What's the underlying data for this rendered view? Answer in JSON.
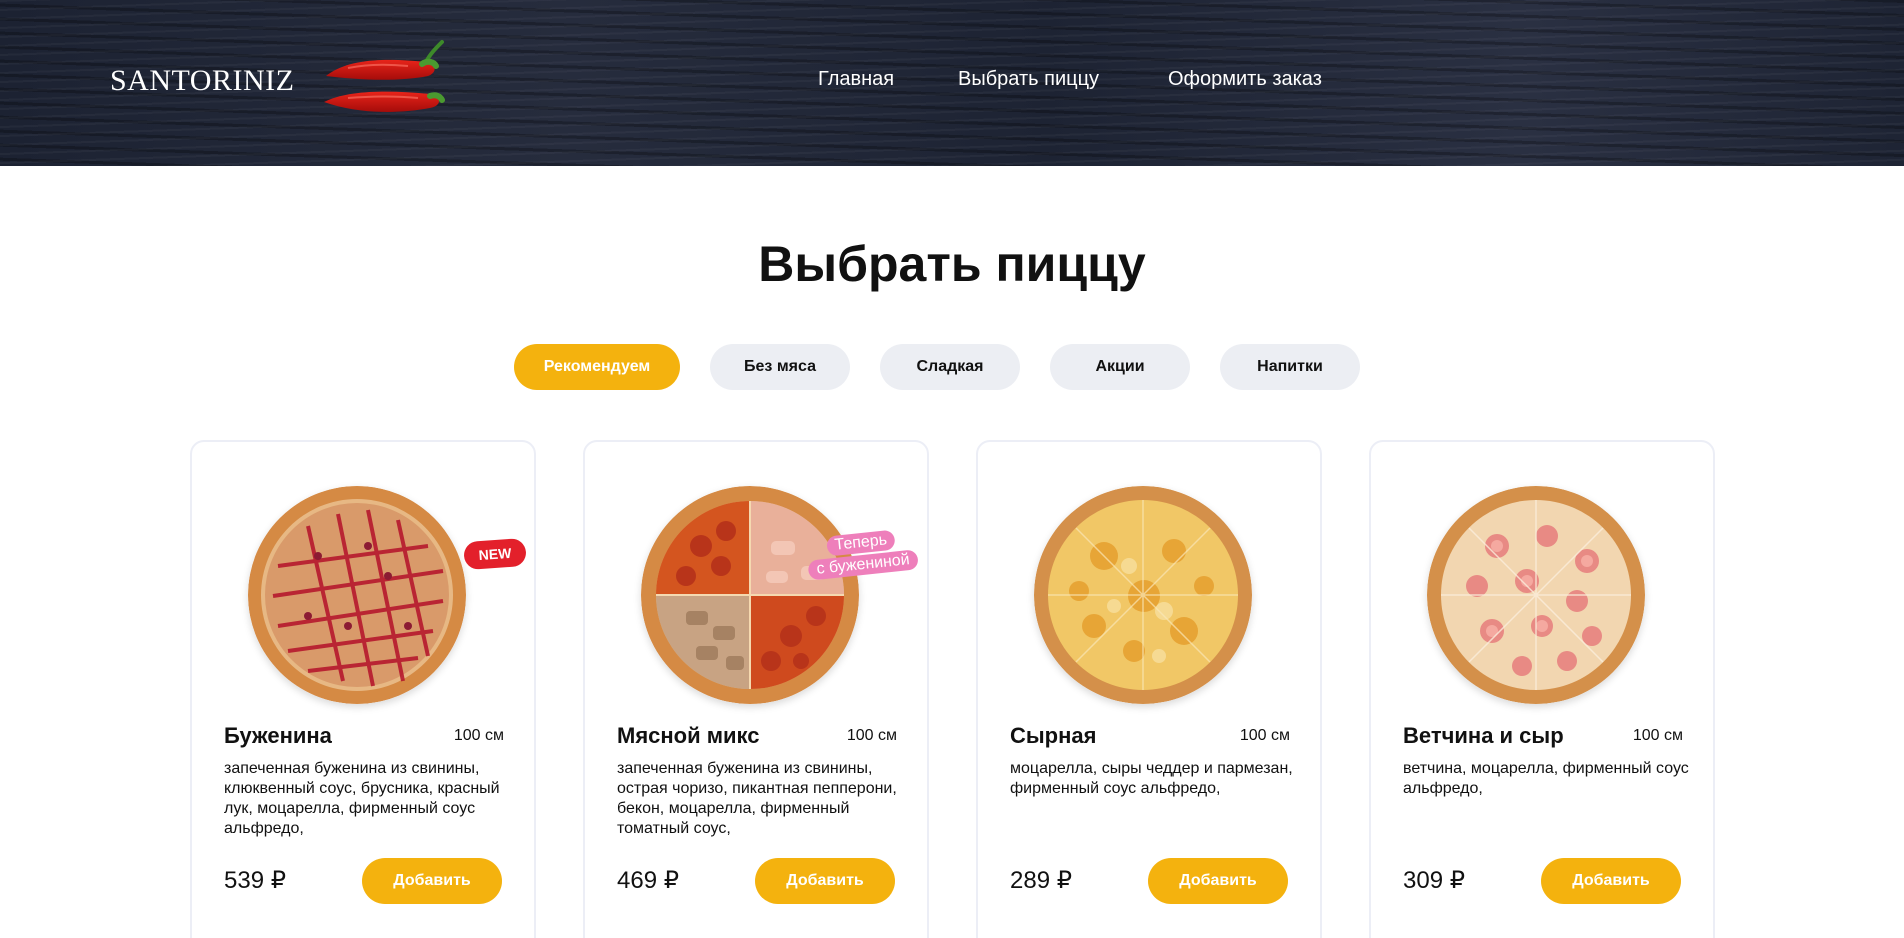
{
  "header": {
    "logo": "SANTORINIZ",
    "nav": [
      {
        "label": "Главная"
      },
      {
        "label": "Выбрать пиццу"
      },
      {
        "label": "Оформить заказ"
      }
    ]
  },
  "page_title": "Выбрать пиццу",
  "filters": [
    {
      "label": "Рекомендуем",
      "active": true
    },
    {
      "label": "Без мяса",
      "active": false
    },
    {
      "label": "Сладкая",
      "active": false
    },
    {
      "label": "Акции",
      "active": false
    },
    {
      "label": "Напитки",
      "active": false
    }
  ],
  "products": [
    {
      "name": "Буженина",
      "size": "100 см",
      "description": "запеченная буженина из свинины, клюквенный соус, брусника, красный лук, моцарелла, фирменный соус альфредо,",
      "price": "539 ₽",
      "button": "Добавить",
      "badge": "NEW"
    },
    {
      "name": "Мясной микс",
      "size": "100 см",
      "description": "запеченная буженина из свинины, острая чоризо, пикантная пепперони, бекон, моцарелла, фирменный томатный соус,",
      "price": "469 ₽",
      "button": "Добавить",
      "badge_lines": [
        "Теперь",
        "с бужениной"
      ]
    },
    {
      "name": "Сырная",
      "size": "100 см",
      "description": "моцарелла, сыры чеддер и пармезан, фирменный соус альфредо,",
      "price": "289 ₽",
      "button": "Добавить"
    },
    {
      "name": "Ветчина и сыр",
      "size": "100 см",
      "description": "ветчина, моцарелла, фирменный соус альфредо,",
      "price": "309 ₽",
      "button": "Добавить"
    }
  ],
  "colors": {
    "accent": "#f4b20e",
    "header_bg": "#1f2535",
    "filter_bg": "#eceef3",
    "badge_new": "#e3202b",
    "badge_pink": "#ee7fbb"
  }
}
